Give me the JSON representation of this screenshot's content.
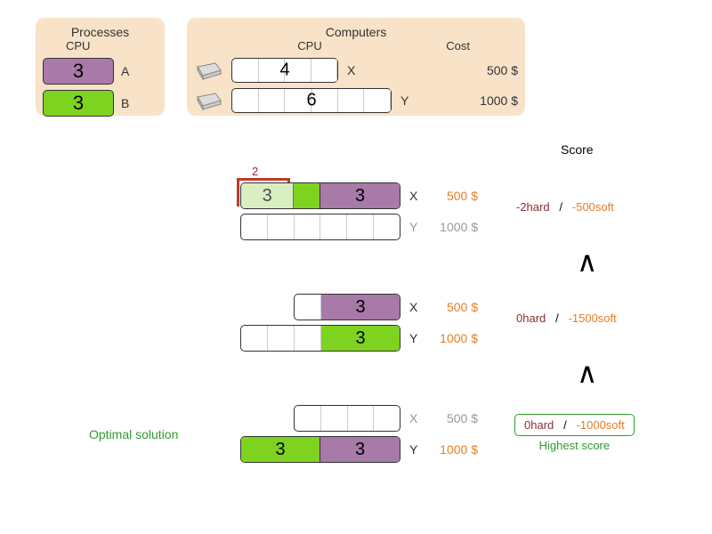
{
  "processes_panel": {
    "title": "Processes",
    "cpu_label": "CPU",
    "items": [
      {
        "value": "3",
        "letter": "A",
        "color": "purple"
      },
      {
        "value": "3",
        "letter": "B",
        "color": "green"
      }
    ]
  },
  "computers_panel": {
    "title": "Computers",
    "cpu_label": "CPU",
    "cost_label": "Cost",
    "items": [
      {
        "cpu": "4",
        "letter": "X",
        "cost": "500 $"
      },
      {
        "cpu": "6",
        "letter": "Y",
        "cost": "1000 $"
      }
    ]
  },
  "score_header": "Score",
  "solutions": [
    {
      "overflow_label": "2",
      "bars": [
        {
          "width": 4,
          "letter": "X",
          "cost": "500 $",
          "cost_color": "orange",
          "letter_color": "#333",
          "segs": [
            {
              "w": 3,
              "v": "3",
              "c": "purple-faded",
              "overflow": true
            },
            {
              "w": 1,
              "v": "",
              "c": "green"
            },
            {
              "w": 3,
              "v": "3",
              "c": "purple"
            }
          ],
          "overflow_extra": 2
        },
        {
          "width": 6,
          "letter": "Y",
          "cost": "1000 $",
          "cost_color": "gray",
          "letter_color": "#999",
          "segs": []
        }
      ],
      "score": {
        "hard": "-2hard",
        "slash": "/",
        "soft": "-500soft"
      }
    },
    {
      "bars": [
        {
          "width": 4,
          "letter": "X",
          "cost": "500 $",
          "cost_color": "orange",
          "letter_color": "#333",
          "segs": [
            {
              "w": 1,
              "v": "",
              "c": "white"
            },
            {
              "w": 3,
              "v": "3",
              "c": "purple"
            }
          ]
        },
        {
          "width": 6,
          "letter": "Y",
          "cost": "1000 $",
          "cost_color": "orange",
          "letter_color": "#333",
          "segs": [
            {
              "w": 3,
              "v": "",
              "c": "white"
            },
            {
              "w": 3,
              "v": "3",
              "c": "green"
            }
          ]
        }
      ],
      "score": {
        "hard": "0hard",
        "slash": "/",
        "soft": "-1500soft"
      }
    },
    {
      "optimal_label": "Optimal solution",
      "bars": [
        {
          "width": 4,
          "letter": "X",
          "cost": "500 $",
          "cost_color": "gray",
          "letter_color": "#999",
          "segs": []
        },
        {
          "width": 6,
          "letter": "Y",
          "cost": "1000 $",
          "cost_color": "orange",
          "letter_color": "#333",
          "segs": [
            {
              "w": 3,
              "v": "3",
              "c": "green"
            },
            {
              "w": 3,
              "v": "3",
              "c": "purple"
            }
          ]
        }
      ],
      "score": {
        "hard": "0hard",
        "slash": "/",
        "soft": "-1000soft",
        "boxed": true,
        "highest": "Highest score"
      }
    }
  ],
  "caret": "∧"
}
